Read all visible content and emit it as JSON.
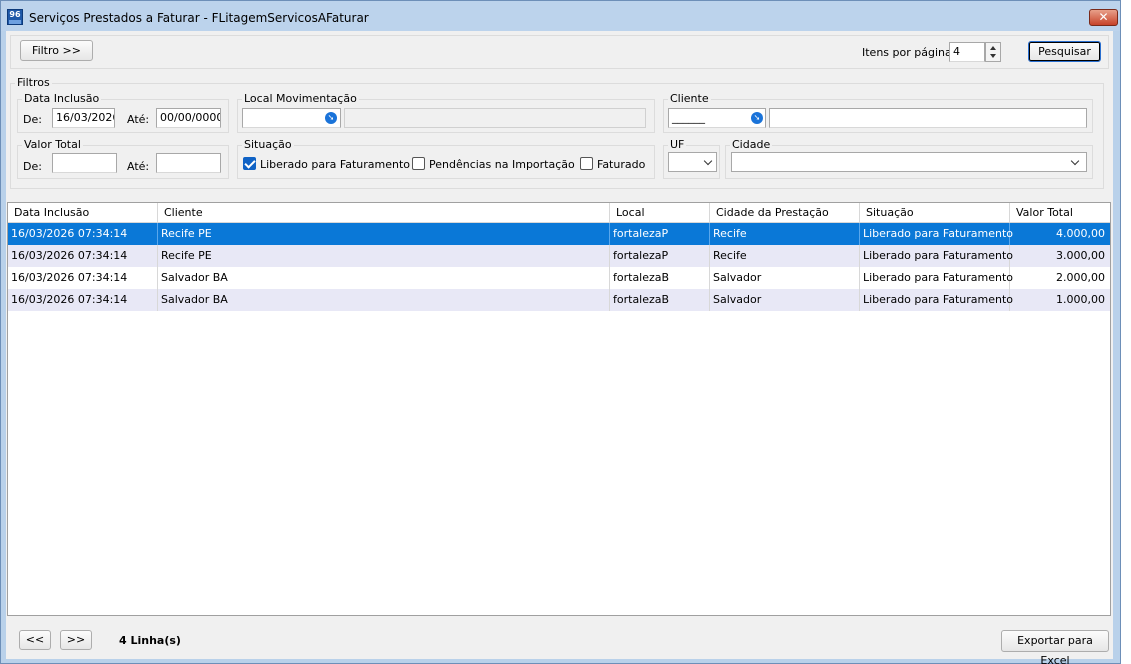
{
  "window": {
    "icon_text": "96",
    "title": "Serviços Prestados a Faturar - FLitagemServicosAFaturar",
    "close_glyph": "✕"
  },
  "toolbar": {
    "filter_button": "Filtro >>",
    "items_per_page_label": "Itens por página",
    "items_per_page_value": "4",
    "search_button": "Pesquisar"
  },
  "filters": {
    "title": "Filtros",
    "data_inclusao": {
      "title": "Data Inclusão",
      "from_label": "De:",
      "from_value": "16/03/2026",
      "to_label": "Até:",
      "to_value": "00/00/0000"
    },
    "local_movimentacao": {
      "title": "Local Movimentação",
      "code_value": "",
      "description_value": ""
    },
    "cliente": {
      "title": "Cliente",
      "code_value": "______",
      "name_value": ""
    },
    "valor_total": {
      "title": "Valor Total",
      "from_label": "De:",
      "from_value": "",
      "to_label": "Até:",
      "to_value": ""
    },
    "situacao": {
      "title": "Situação",
      "options": [
        {
          "label": "Liberado para Faturamento",
          "checked": true
        },
        {
          "label": "Pendências na Importação",
          "checked": false
        },
        {
          "label": "Faturado",
          "checked": false
        }
      ]
    },
    "uf": {
      "title": "UF",
      "value": ""
    },
    "cidade": {
      "title": "Cidade",
      "value": ""
    }
  },
  "grid": {
    "columns": [
      "Data Inclusão",
      "Cliente",
      "Local",
      "Cidade da Prestação",
      "Situação",
      "Valor Total"
    ],
    "rows": [
      [
        "16/03/2026 07:34:14",
        "Recife PE",
        "fortalezaP",
        "Recife",
        "Liberado para Faturamento",
        "4.000,00"
      ],
      [
        "16/03/2026 07:34:14",
        "Recife PE",
        "fortalezaP",
        "Recife",
        "Liberado para Faturamento",
        "3.000,00"
      ],
      [
        "16/03/2026 07:34:14",
        "Salvador BA",
        "fortalezaB",
        "Salvador",
        "Liberado para Faturamento",
        "2.000,00"
      ],
      [
        "16/03/2026 07:34:14",
        "Salvador BA",
        "fortalezaB",
        "Salvador",
        "Liberado para Faturamento",
        "1.000,00"
      ]
    ],
    "selected_row": 0
  },
  "footer": {
    "prev_button": "<<",
    "next_button": ">>",
    "row_count": "4 Linha(s)",
    "export_button": "Exportar para Excel"
  },
  "colors": {
    "selection": "#0a78d7",
    "alt_row": "#e8e8f6",
    "window_frame": "#b9d1ea"
  }
}
